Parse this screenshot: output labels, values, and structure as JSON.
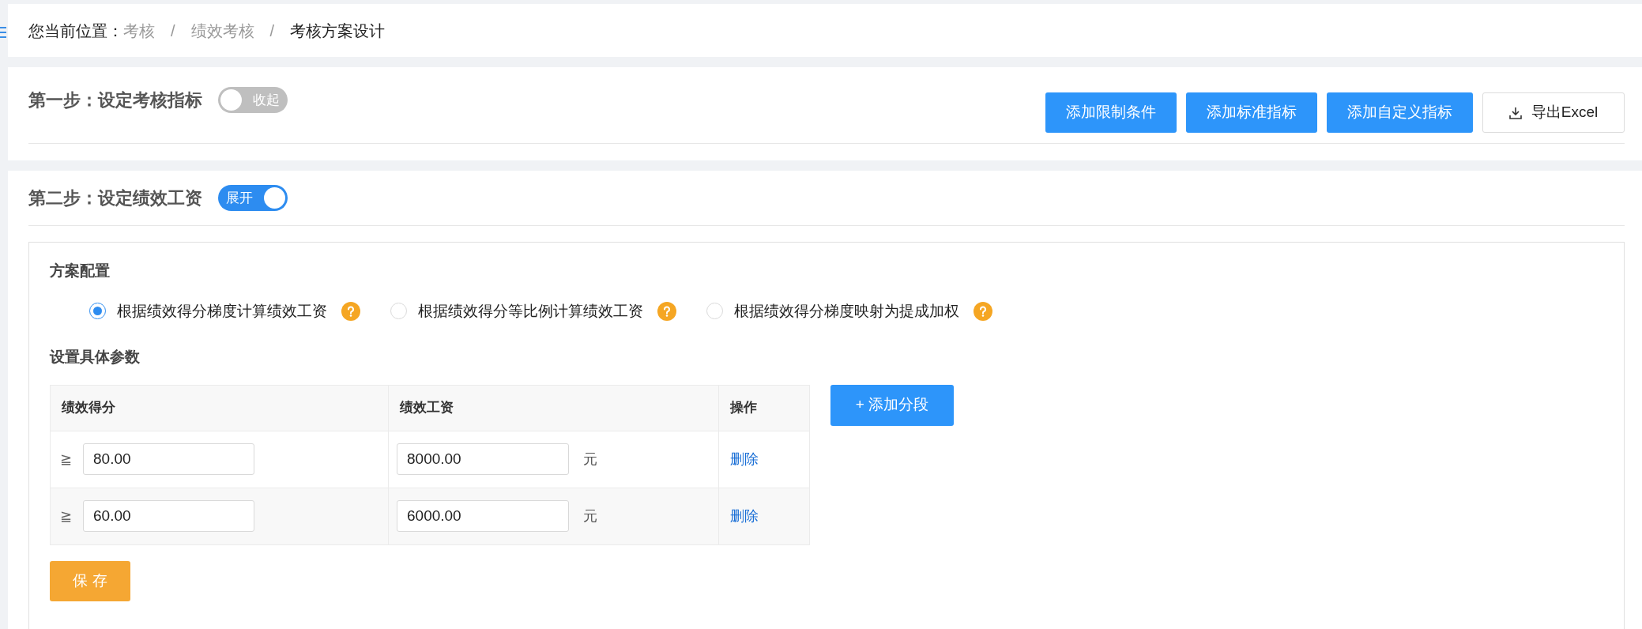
{
  "breadcrumb": {
    "prefix": "您当前位置：",
    "items": [
      {
        "label": "考核",
        "current": false
      },
      {
        "label": "绩效考核",
        "current": false
      },
      {
        "label": "考核方案设计",
        "current": true
      }
    ],
    "separator": "/"
  },
  "step1": {
    "title": "第一步：设定考核指标",
    "toggle": {
      "label": "收起",
      "on": false
    },
    "buttons": [
      {
        "label": "添加限制条件",
        "kind": "primary"
      },
      {
        "label": "添加标准指标",
        "kind": "primary"
      },
      {
        "label": "添加自定义指标",
        "kind": "primary"
      },
      {
        "label": "导出Excel",
        "kind": "export"
      }
    ]
  },
  "step2": {
    "title": "第二步：设定绩效工资",
    "toggle": {
      "label": "展开",
      "on": true
    },
    "config_title": "方案配置",
    "options": [
      {
        "label": "根据绩效得分梯度计算绩效工资",
        "selected": true
      },
      {
        "label": "根据绩效得分等比例计算绩效工资",
        "selected": false
      },
      {
        "label": "根据绩效得分梯度映射为提成加权",
        "selected": false
      }
    ],
    "params_title": "设置具体参数",
    "table": {
      "columns": [
        "绩效得分",
        "绩效工资",
        "操作"
      ],
      "rows": [
        {
          "symbol": "≧",
          "score": "80.00",
          "salary": "8000.00",
          "unit": "元",
          "action": "删除"
        },
        {
          "symbol": "≧",
          "score": "60.00",
          "salary": "6000.00",
          "unit": "元",
          "action": "删除"
        }
      ]
    },
    "add_button": "+ 添加分段",
    "save_button": "保 存"
  }
}
